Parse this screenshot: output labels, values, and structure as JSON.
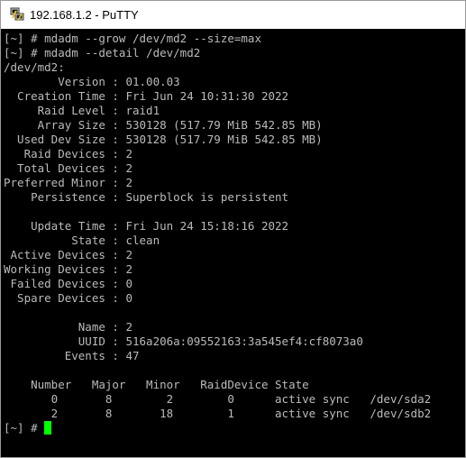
{
  "window": {
    "title": "192.168.1.2 - PuTTY",
    "icon": "putty-terminal-icon"
  },
  "terminal": {
    "lines": [
      "[~] # mdadm --grow /dev/md2 --size=max",
      "[~] # mdadm --detail /dev/md2",
      "/dev/md2:",
      "        Version : 01.00.03",
      "  Creation Time : Fri Jun 24 10:31:30 2022",
      "     Raid Level : raid1",
      "     Array Size : 530128 (517.79 MiB 542.85 MB)",
      "  Used Dev Size : 530128 (517.79 MiB 542.85 MB)",
      "   Raid Devices : 2",
      "  Total Devices : 2",
      "Preferred Minor : 2",
      "    Persistence : Superblock is persistent",
      "",
      "    Update Time : Fri Jun 24 15:18:16 2022",
      "          State : clean",
      " Active Devices : 2",
      "Working Devices : 2",
      " Failed Devices : 0",
      "  Spare Devices : 0",
      "",
      "           Name : 2",
      "           UUID : 516a206a:09552163:3a545ef4:cf8073a0",
      "         Events : 47",
      "",
      "    Number   Major   Minor   RaidDevice State",
      "       0       8        2        0      active sync   /dev/sda2",
      "       2       8       18        1      active sync   /dev/sdb2"
    ],
    "prompt": "[~] # ",
    "colors": {
      "background": "#000000",
      "foreground": "#bbbbbb",
      "cursor": "#00ff00"
    }
  }
}
